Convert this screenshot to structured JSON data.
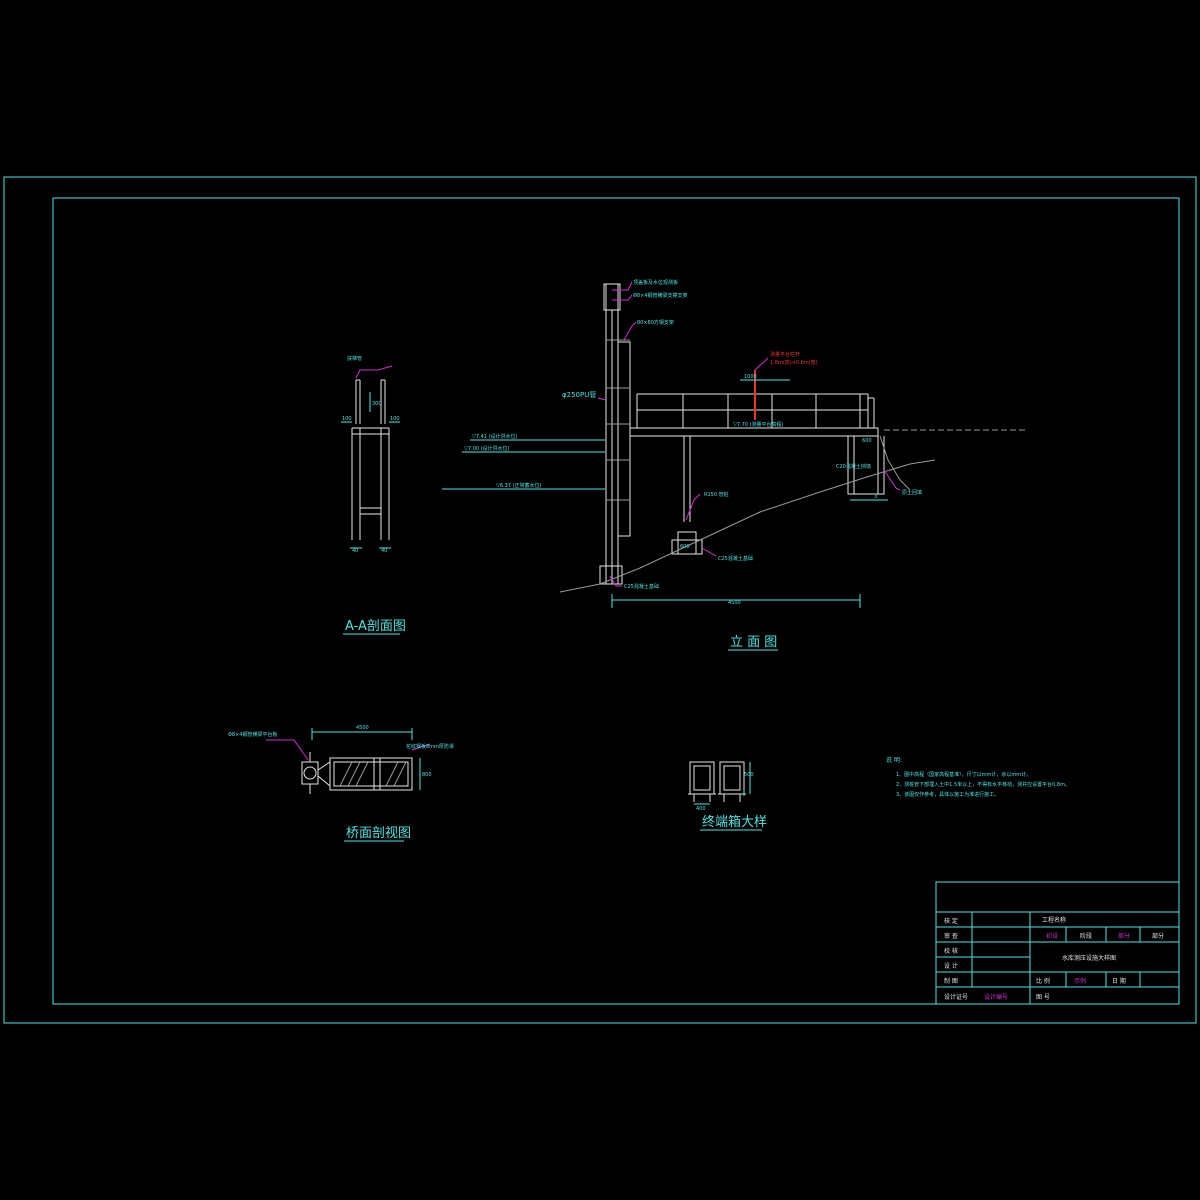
{
  "colors": {
    "background": "#000000",
    "frame": "#4fe3e3",
    "structure": "#e6e6e6",
    "leader": "#d22fd2",
    "highlight": "#ee3333"
  },
  "views": {
    "section_aa": {
      "title": "A-A剖面图",
      "label_top": "扶梯管",
      "dim_a": "40",
      "dim_b": "40",
      "dim_c": "100",
      "dim_d": "100",
      "dim_e": "300"
    },
    "elevation": {
      "title": "立 面 图",
      "pipe_label": "φ250PU管",
      "top_label_1": "顶盖板及水位观测板",
      "top_label_2": "Φ8×4钢管横梁支撑支架",
      "top_label_3": "80×80方钢支架",
      "red_label_1": "测量平台栏杆",
      "red_label_2": "1.8m(高)×0.6m(宽)",
      "level_1": "▽7.41 (设计洪水位)",
      "level_2": "▽7.00 (设计洪水位)",
      "level_3": "▽6.37 (正常蓄水位)",
      "deck_label": "▽7.70 (测量平台高程)",
      "deck_dim": "1000",
      "pier_label": "R150 管桩",
      "base_label_1": "C25混凝土基础",
      "base_label_2": "C25混凝土基础",
      "base_dim": "600",
      "bank_label": "原土回填",
      "right_dim_1": "600",
      "right_dim_2": "3",
      "right_note": "C20混凝土挡墙",
      "span_dim": "4500"
    },
    "bridge_plan": {
      "title": "桥面剖视图",
      "left_label": "Φ8×4钢管横梁平台板",
      "right_label": "花纹钢板8mm厚防滑",
      "span_dim": "4500",
      "height_dim": "800"
    },
    "terminal_box": {
      "title": "终端箱大样",
      "dim": "500",
      "dim_b": "400"
    }
  },
  "notes": {
    "heading": "说 明:",
    "items": [
      "1、图中高程（国家高程基准），尺寸以mm计，余以mm计。",
      "2、测桩管下部埋入土中1.5米以上，不得有水平移动，测井应设置平台0.8m。",
      "3、该图仅作参考，具体以施工为准进行施工。"
    ]
  },
  "title_block": {
    "rows": [
      {
        "label": "核 定",
        "value": ""
      },
      {
        "label": "审 查",
        "value": ""
      },
      {
        "label": "校 核",
        "value": ""
      },
      {
        "label": "设 计",
        "value": ""
      },
      {
        "label": "制 图",
        "value": ""
      },
      {
        "label": "设计证号",
        "value": "设计编号"
      }
    ],
    "project_label": "工程名称",
    "stage_1": "初设",
    "stage_2": "阶段",
    "part_1": "部分",
    "part_2": "部分",
    "drawing_name": "水库测压设施大样图",
    "scale_label": "比 例",
    "scale_value": "示例",
    "date_label": "日 期",
    "drawing_no_label": "图 号"
  }
}
